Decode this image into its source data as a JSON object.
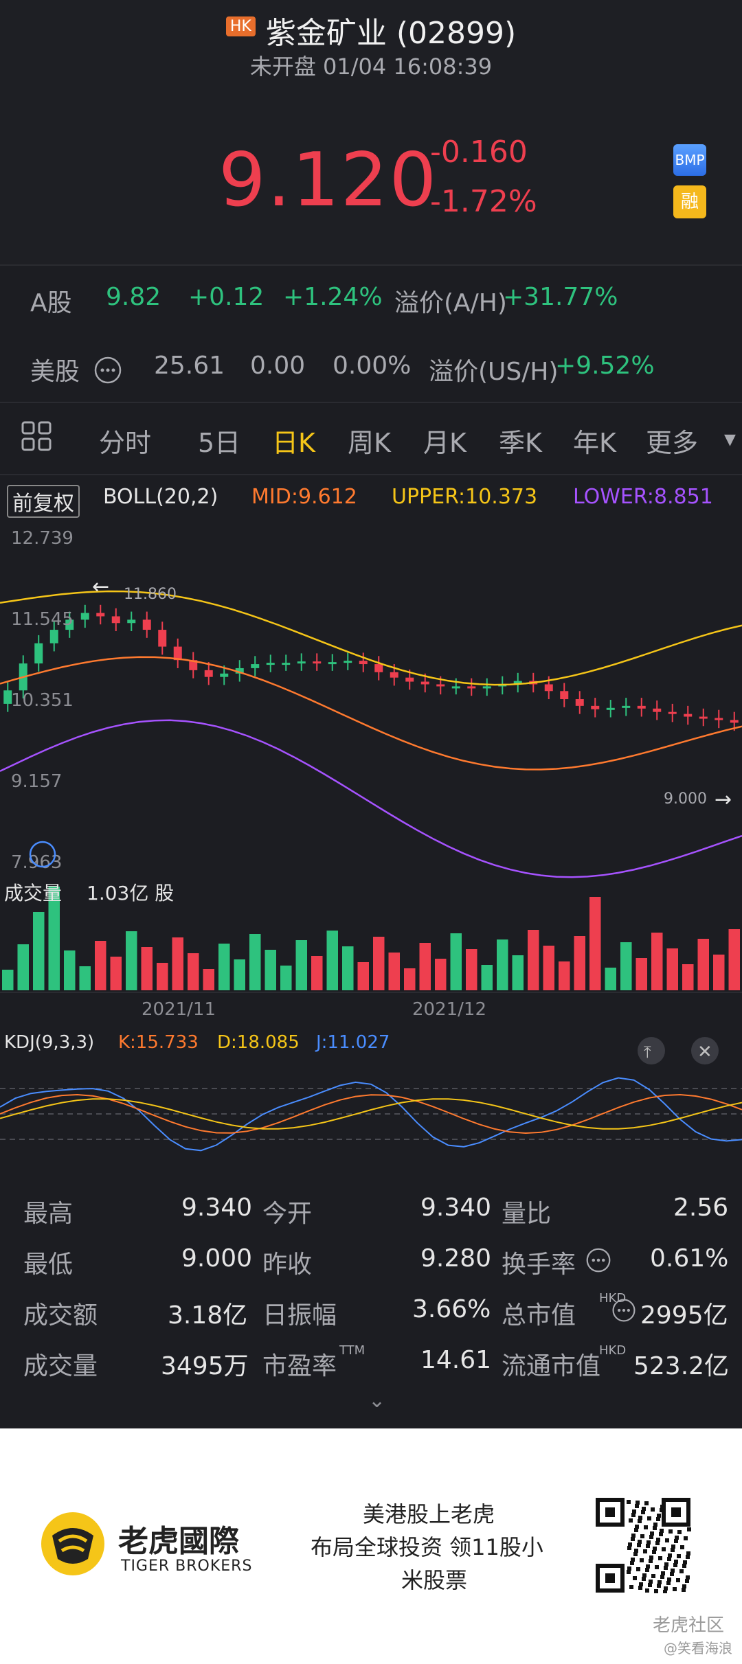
{
  "header": {
    "badge": "HK",
    "title": "紫金矿业 (02899)",
    "status": "未开盘 01/04 16:08:39",
    "price": "9.120",
    "change": "-0.160",
    "change_pct": "-1.72%",
    "bmp_label": "BMP",
    "rong_label": "融"
  },
  "markets": {
    "a_share": {
      "label": "A股",
      "price": "9.82",
      "change": "+0.12",
      "pct": "+1.24%",
      "premium_label": "溢价(A/H)",
      "premium": "+31.77%"
    },
    "us_share": {
      "label": "美股",
      "price": "25.61",
      "change": "0.00",
      "pct": "0.00%",
      "premium_label": "溢价(US/H)",
      "premium": "+9.52%"
    }
  },
  "tabs": [
    "分时",
    "5日",
    "日K",
    "周K",
    "月K",
    "季K",
    "年K",
    "更多"
  ],
  "active_tab": "日K",
  "boll": {
    "fq": "前复权",
    "name": "BOLL(20,2)",
    "mid": "MID:9.612",
    "upper": "UPPER:10.373",
    "lower": "LOWER:8.851"
  },
  "price_axis": [
    "12.739",
    "11.545",
    "10.351",
    "9.157",
    "7.963"
  ],
  "markers": {
    "high": "11.860",
    "low": "9.000"
  },
  "volume": {
    "label": "成交量",
    "value": "1.03亿 股",
    "dates": [
      "2021/11",
      "2021/12"
    ]
  },
  "kdj": {
    "name": "KDJ(9,3,3)",
    "k": "K:15.733",
    "d": "D:18.085",
    "j": "J:11.027"
  },
  "colors": {
    "up": "#ee3f4f",
    "down": "#2ec27e",
    "mid": "#ff7a2f",
    "upper": "#f5c518",
    "lower": "#a653ff",
    "kline_j": "#4a8dff"
  },
  "stats": [
    [
      {
        "label": "最高",
        "value": "9.340"
      },
      {
        "label": "今开",
        "value": "9.340"
      },
      {
        "label": "量比",
        "value": "2.56"
      }
    ],
    [
      {
        "label": "最低",
        "value": "9.000"
      },
      {
        "label": "昨收",
        "value": "9.280"
      },
      {
        "label": "换手率",
        "value": "0.61%"
      }
    ],
    [
      {
        "label": "成交额",
        "value": "3.18亿"
      },
      {
        "label": "日振幅",
        "value": "3.66%"
      },
      {
        "label": "总市值",
        "value": "2995亿"
      }
    ],
    [
      {
        "label": "成交量",
        "value": "3495万"
      },
      {
        "label": "市盈率",
        "value": "14.61"
      },
      {
        "label": "流通市值",
        "value": "523.2亿"
      }
    ]
  ],
  "stats_sup": {
    "ttm": "TTM",
    "hkd": "HKD"
  },
  "footer": {
    "brand_cn": "老虎國際",
    "brand_en": "TIGER BROKERS",
    "slogan1": "美港股上老虎",
    "slogan2": "布局全球投资 领11股小",
    "slogan3": "米股票",
    "watermark": "老虎社区",
    "watermark2": "@笑看海浪"
  }
}
